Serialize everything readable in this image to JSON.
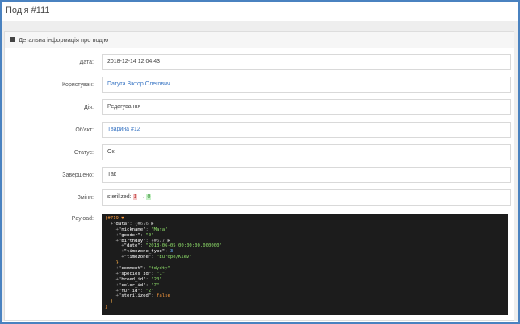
{
  "page": {
    "title": "Подія #111"
  },
  "panel": {
    "title": "Детальна інформація про подію"
  },
  "rows": {
    "date": {
      "label": "Дата:",
      "value": "2018-12-14 12:04:43"
    },
    "user": {
      "label": "Користувач:",
      "value": "Патута Віктор Олегович"
    },
    "action": {
      "label": "Дія:",
      "value": "Редагування"
    },
    "object": {
      "label": "Об'єкт:",
      "value": "Тварина #12"
    },
    "status": {
      "label": "Статус:",
      "value": "Ок"
    },
    "done": {
      "label": "Завершено:",
      "value": "Так"
    },
    "changes": {
      "label": "Зміни:",
      "field": "sterilized:",
      "old": "1",
      "arrow": "→",
      "new": "0"
    }
  },
  "payload": {
    "label": "Payload:",
    "lines": [
      [
        [
          "o",
          "{#719 ▼"
        ]
      ],
      [
        [
          "g",
          "  +"
        ],
        [
          "k",
          "\"data\""
        ],
        [
          "g",
          ": {#676 ▶"
        ]
      ],
      [
        [
          "g",
          "    +"
        ],
        [
          "k",
          "\"nickname\""
        ],
        [
          "g",
          ": "
        ],
        [
          "s",
          "\"Мата\""
        ]
      ],
      [
        [
          "g",
          "    +"
        ],
        [
          "k",
          "\"gender\""
        ],
        [
          "g",
          ": "
        ],
        [
          "s",
          "\"0\""
        ]
      ],
      [
        [
          "g",
          "    +"
        ],
        [
          "k",
          "\"birthday\""
        ],
        [
          "g",
          ": {#677 ▶"
        ]
      ],
      [
        [
          "g",
          "      +"
        ],
        [
          "k",
          "\"date\""
        ],
        [
          "g",
          ": "
        ],
        [
          "s",
          "\"2018-06-05 00:00:00.000000\""
        ]
      ],
      [
        [
          "g",
          "      +"
        ],
        [
          "k",
          "\"timezone_type\""
        ],
        [
          "g",
          ": "
        ],
        [
          "n",
          "3"
        ]
      ],
      [
        [
          "g",
          "      +"
        ],
        [
          "k",
          "\"timezone\""
        ],
        [
          "g",
          ": "
        ],
        [
          "s",
          "\"Europe/Kiev\""
        ]
      ],
      [
        [
          "b",
          "    }"
        ]
      ],
      [
        [
          "g",
          "    +"
        ],
        [
          "k",
          "\"comment\""
        ],
        [
          "g",
          ": "
        ],
        [
          "s",
          "\"tdydty\""
        ]
      ],
      [
        [
          "g",
          "    +"
        ],
        [
          "k",
          "\"species_id\""
        ],
        [
          "g",
          ": "
        ],
        [
          "s",
          "\"1\""
        ]
      ],
      [
        [
          "g",
          "    +"
        ],
        [
          "k",
          "\"breed_id\""
        ],
        [
          "g",
          ": "
        ],
        [
          "s",
          "\"20\""
        ]
      ],
      [
        [
          "g",
          "    +"
        ],
        [
          "k",
          "\"color_id\""
        ],
        [
          "g",
          ": "
        ],
        [
          "s",
          "\"7\""
        ]
      ],
      [
        [
          "g",
          "    +"
        ],
        [
          "k",
          "\"fur_id\""
        ],
        [
          "g",
          ": "
        ],
        [
          "s",
          "\"2\""
        ]
      ],
      [
        [
          "g",
          "    +"
        ],
        [
          "k",
          "\"sterilized\""
        ],
        [
          "g",
          ": "
        ],
        [
          "kw",
          "false"
        ]
      ],
      [
        [
          "b",
          "  }"
        ]
      ],
      [
        [
          "o",
          "}"
        ]
      ]
    ]
  },
  "colors": {
    "frame": "#4a82c0",
    "link": "#3a76c4",
    "payload_bg": "#1c1c1c"
  }
}
